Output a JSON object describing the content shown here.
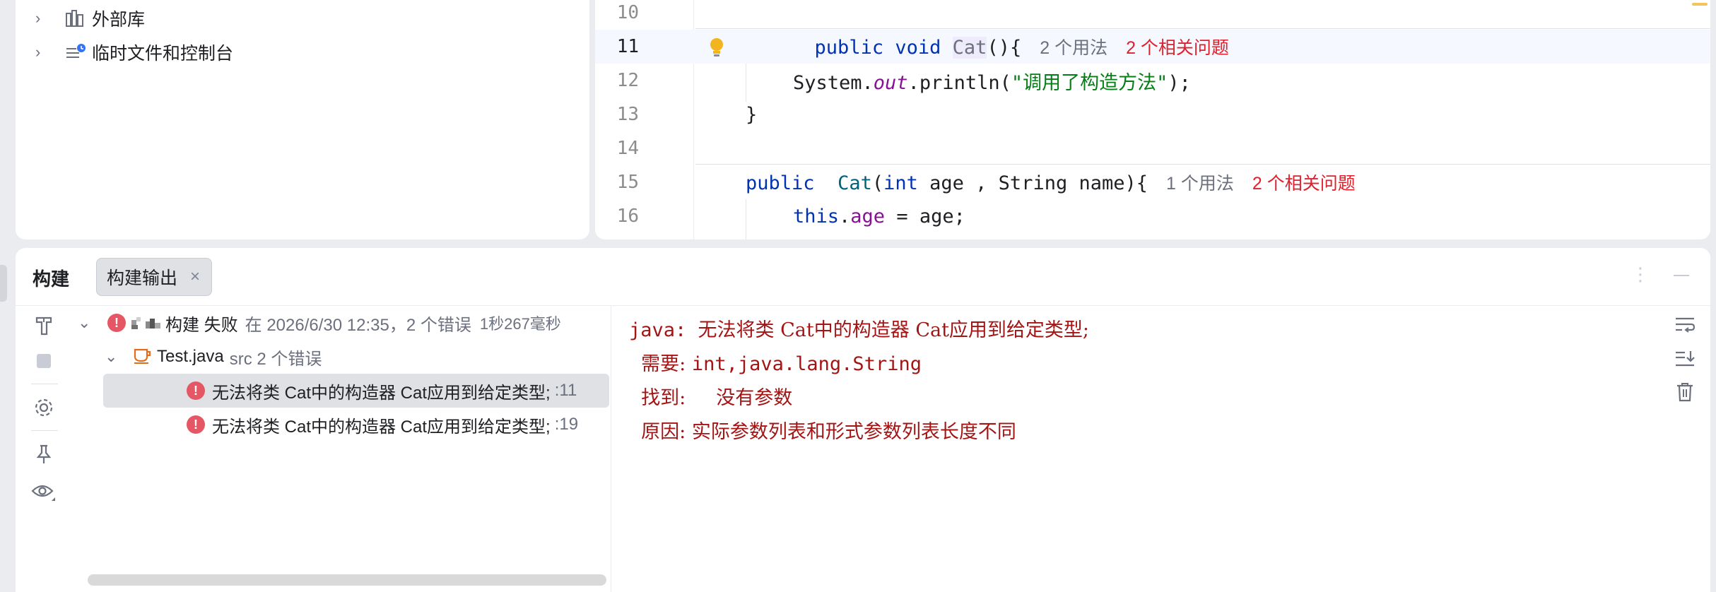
{
  "project_tree": {
    "items": [
      {
        "label": "外部库",
        "icon": "library-icon"
      },
      {
        "label": "临时文件和控制台",
        "icon": "scratches-icon"
      }
    ]
  },
  "editor": {
    "lines": [
      {
        "num": "10"
      },
      {
        "num": "11",
        "kw1": "public",
        "kw2": "void",
        "name": "Cat",
        "rest": "(){",
        "usages": "2 个用法",
        "problems": "2 个相关问题"
      },
      {
        "num": "12",
        "obj": "System.",
        "field": "out",
        "call": ".println(",
        "str": "\"调用了构造方法\"",
        "end": ");"
      },
      {
        "num": "13",
        "text": "}"
      },
      {
        "num": "14"
      },
      {
        "num": "15",
        "kw1": "public",
        "name": "Cat",
        "open": "(",
        "kw_int": "int",
        "params": " age , String name){",
        "usages": "1 个用法",
        "problems": "2 个相关问题"
      },
      {
        "num": "16",
        "kw_this": "this",
        "dot": ".",
        "field": "age",
        "rest": " = age;"
      }
    ]
  },
  "build": {
    "title": "构建",
    "tab_label": "构建输出",
    "tab_close": "×",
    "tree": {
      "root": {
        "status": "构建 失败",
        "details": "在 2026/6/30 12:35，2 个错误",
        "duration": "1秒267毫秒"
      },
      "file": {
        "name": "Test.java",
        "details": "src 2 个错误"
      },
      "errors": [
        {
          "message": "无法将类 Cat中的构造器 Cat应用到给定类型;",
          "line": ":11"
        },
        {
          "message": "无法将类 Cat中的构造器 Cat应用到给定类型;",
          "line": ":19"
        }
      ]
    },
    "console": {
      "line1_prefix": "java: ",
      "line1_text": "无法将类 Cat中的构造器 Cat应用到给定类型;",
      "required_label": "  需要: ",
      "required_value": "int,java.lang.String",
      "found_label": "  找到: ",
      "found_value": "    没有参数",
      "reason_label": "  原因: ",
      "reason_value": "实际参数列表和形式参数列表长度不同"
    }
  },
  "colors": {
    "error": "#e55765",
    "keyword": "#0033b3",
    "string": "#067d17",
    "console_error_text": "#a31515"
  }
}
